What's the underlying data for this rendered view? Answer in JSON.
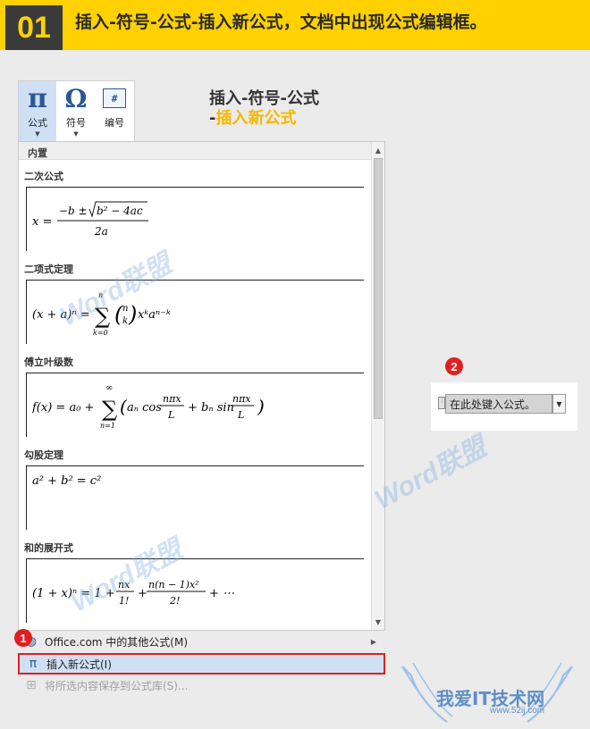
{
  "banner": {
    "step": "01",
    "title": "插入-符号-公式-插入新公式，文档中出现公式编辑框。"
  },
  "caption": {
    "line1": "插入-符号-公式",
    "line2_dash": "-",
    "line2": "插入新公式"
  },
  "ribbon": {
    "equation_icon": "π",
    "equation_label": "公式",
    "symbol_icon": "Ω",
    "symbol_label": "符号",
    "number_icon": "#",
    "number_label": "编号"
  },
  "gallery": {
    "header": "内置",
    "equations": [
      {
        "title": "二次公式"
      },
      {
        "title": "二项式定理"
      },
      {
        "title": "傅立叶级数"
      },
      {
        "title": "勾股定理"
      },
      {
        "title": "和的展开式"
      }
    ]
  },
  "menu": {
    "more_equations": "Office.com 中的其他公式(M)",
    "insert_new": "插入新公式(I)",
    "save_selection": "将所选内容保存到公式库(S)..."
  },
  "badges": {
    "first": "1",
    "second": "2"
  },
  "placeholder": {
    "text": "在此处键入公式。"
  },
  "watermarks": {
    "word": "Word联盟",
    "site_name": "我爱IT技术网",
    "site_url": "www.52ij.com"
  },
  "colors": {
    "banner": "#ffd100",
    "accent": "#2b5797",
    "highlight_border": "#e02020",
    "caption_accent": "#f5b800"
  }
}
